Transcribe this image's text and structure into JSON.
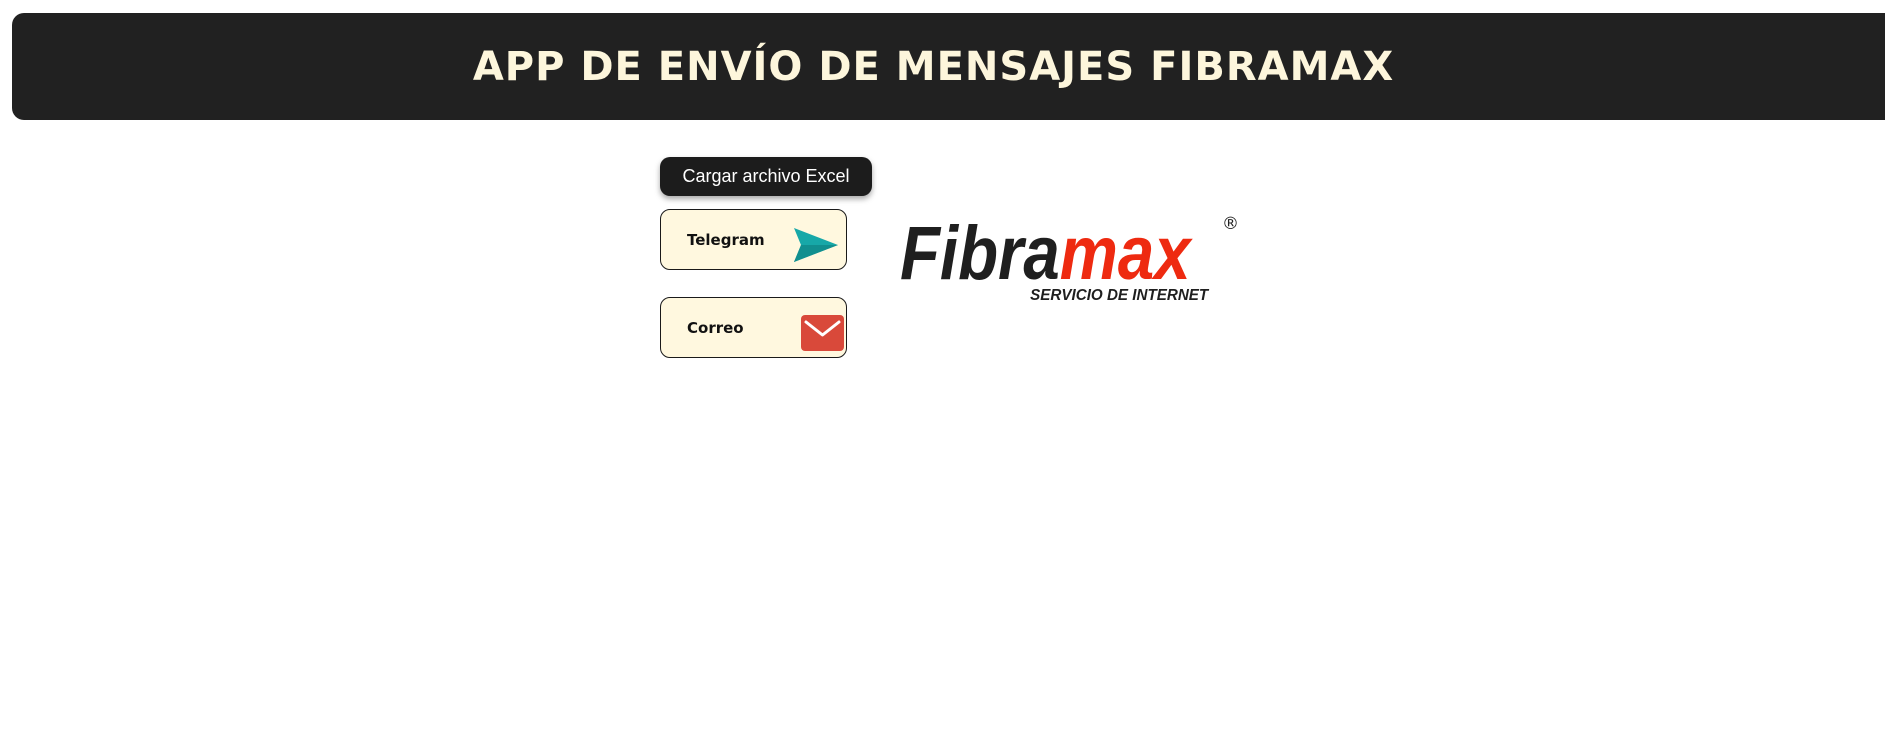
{
  "header": {
    "title": "APP DE ENVÍO DE MENSAJES FIBRAMAX"
  },
  "actions": {
    "load_excel_label": "Cargar archivo Excel",
    "telegram_label": "Telegram",
    "correo_label": "Correo"
  },
  "icons": {
    "telegram": "send-arrow",
    "correo": "envelope"
  },
  "logo": {
    "brand_dark": "Fibra",
    "brand_accent": "max",
    "registered": "®",
    "tagline": "SERVICIO DE INTERNET"
  },
  "colors": {
    "header_bg": "#212121",
    "header_text": "#fdf6dc",
    "button_dark": "#1c1c1c",
    "channel_bg": "#fff8df",
    "telegram_icon": "#17a8a8",
    "mail_icon": "#d9493a",
    "brand_dark": "#1f1f1f",
    "brand_accent": "#ee2a10"
  }
}
